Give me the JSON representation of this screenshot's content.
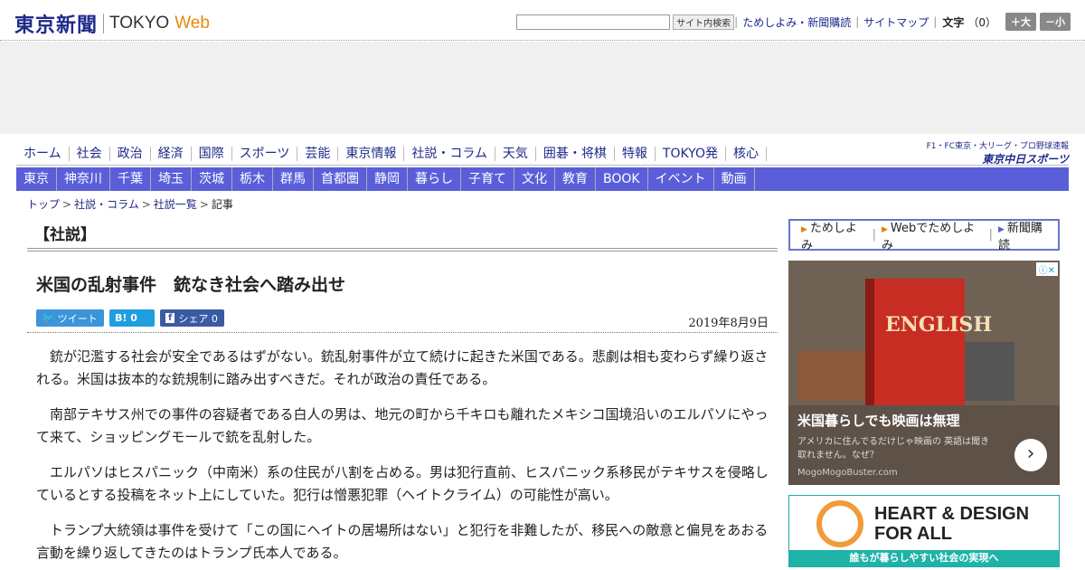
{
  "header": {
    "logo_jp": "東京新聞",
    "logo_en": "TOKYO",
    "logo_web": "Web",
    "search_button": "サイト内検索",
    "links": [
      "ためしよみ・新聞購読",
      "サイトマップ"
    ],
    "font_size_label": "文字",
    "font_size_count": "（0）",
    "larger": "＋大",
    "smaller": "－小"
  },
  "nav_main": [
    "ホーム",
    "社会",
    "政治",
    "経済",
    "国際",
    "スポーツ",
    "芸能",
    "東京情報",
    "社説・コラム",
    "天気",
    "囲碁・将棋",
    "特報",
    "TOKYO発",
    "核心"
  ],
  "chunichi": {
    "top": "F1・FC東京・大リーグ・プロ野球速報",
    "main": "東京中日スポーツ"
  },
  "nav_sub": [
    "東京",
    "神奈川",
    "千葉",
    "埼玉",
    "茨城",
    "栃木",
    "群馬",
    "首都圏",
    "静岡",
    "暮らし",
    "子育て",
    "文化",
    "教育",
    "BOOK",
    "イベント",
    "動画"
  ],
  "breadcrumb": [
    "トップ",
    "社説・コラム",
    "社説一覧",
    "記事"
  ],
  "article": {
    "section": "【社説】",
    "title": "米国の乱射事件　銃なき社会へ踏み出せ",
    "date": "2019年8月9日",
    "share": {
      "tweet": "ツイート",
      "hatena": "B! 0",
      "facebook": "シェア 0"
    },
    "paragraphs": [
      "銃が氾濫する社会が安全であるはずがない。銃乱射事件が立て続けに起きた米国である。悲劇は相も変わらず繰り返される。米国は抜本的な銃規制に踏み出すべきだ。それが政治の責任である。",
      "南部テキサス州での事件の容疑者である白人の男は、地元の町から千キロも離れたメキシコ国境沿いのエルパソにやって来て、ショッピングモールで銃を乱射した。",
      "エルパソはヒスパニック（中南米）系の住民が八割を占める。男は犯行直前、ヒスパニック系移民がテキサスを侵略しているとする投稿をネット上にしていた。犯行は憎悪犯罪（ヘイトクライム）の可能性が高い。",
      "トランプ大統領は事件を受けて「この国にヘイトの居場所はない」と犯行を非難したが、移民への敵意と偏見をあおる言動を繰り返してきたのはトランプ氏本人である。"
    ]
  },
  "sidebar": {
    "subscribe": [
      "ためしよみ",
      "Webでためしよみ",
      "新聞購読"
    ],
    "ad1": {
      "book_title": "ENGLISH",
      "title": "米国暮らしでも映画は無理",
      "desc": "アメリカに住んでるだけじゃ映画の 英語は聞き取れません。なぜ？",
      "source": "MogoMogoBuster.com"
    },
    "ad2": {
      "title": "HEART & DESIGN FOR ALL",
      "strip": "誰もが暮らしやすい社会の実現へ"
    }
  }
}
